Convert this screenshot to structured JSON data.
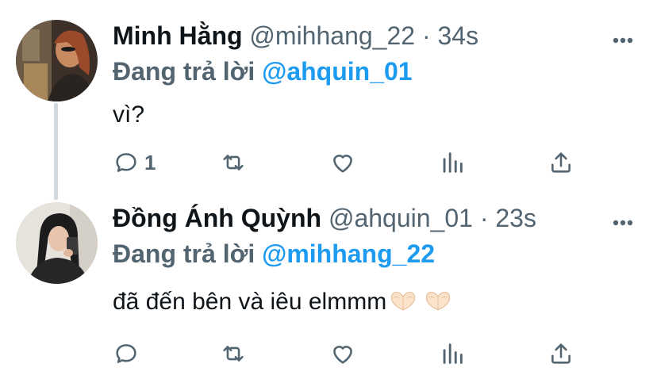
{
  "tweets": [
    {
      "display_name": "Minh Hằng",
      "handle": "@mihhang_22",
      "separator": "·",
      "time": "34s",
      "reply_prefix": "Đang trả lời",
      "reply_to": "@ahquin_01",
      "text": "vì?",
      "reply_count": "1",
      "icons": [
        "reply-icon",
        "retweet-icon",
        "like-icon",
        "views-icon",
        "share-icon",
        "more-icon"
      ]
    },
    {
      "display_name": "Đồng Ánh Quỳnh",
      "handle": "@ahquin_01",
      "separator": "·",
      "time": "23s",
      "reply_prefix": "Đang trả lời",
      "reply_to": "@mihhang_22",
      "text": "đã đến bên và iêu elmmm",
      "text_emoji": "heart-hands-emoji",
      "reply_count": "",
      "icons": [
        "reply-icon",
        "retweet-icon",
        "like-icon",
        "views-icon",
        "share-icon",
        "more-icon"
      ]
    }
  ],
  "colors": {
    "text": "#0f1419",
    "secondary": "#536471",
    "mention": "#1d9bf0",
    "thread_line": "#cfd9de"
  }
}
